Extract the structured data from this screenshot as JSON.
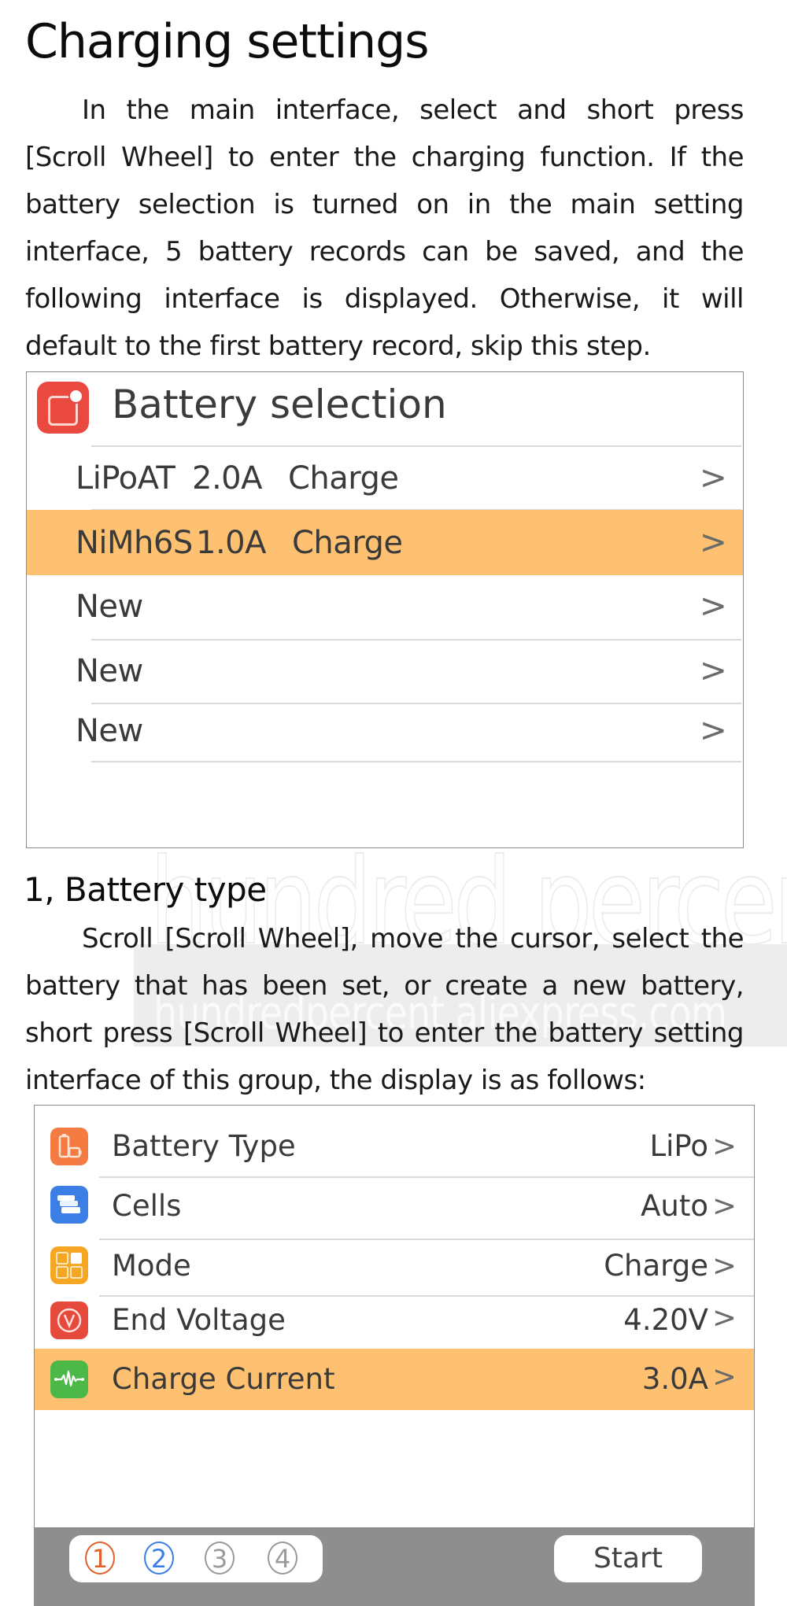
{
  "title": "Charging settings",
  "intro_paragraph": "In the main interface, select and short press [Scroll Wheel] to enter the charging function. If the battery selection is turned on in the main setting interface, 5 battery records can be saved, and the following interface is displayed. Otherwise, it will default to the first battery record, skip this step.",
  "battery_selection": {
    "title": "Battery selection",
    "icon": "app-badge-icon",
    "rows": [
      {
        "name": "LiPoAT",
        "current": "2.0A",
        "mode": "Charge",
        "chevron": ">",
        "selected": false
      },
      {
        "name": "NiMh6S",
        "current": "1.0A",
        "mode": "Charge",
        "chevron": ">",
        "selected": true
      },
      {
        "name": "New",
        "current": "",
        "mode": "",
        "chevron": ">",
        "selected": false
      },
      {
        "name": "New",
        "current": "",
        "mode": "",
        "chevron": ">",
        "selected": false
      },
      {
        "name": "New",
        "current": "",
        "mode": "",
        "chevron": ">",
        "selected": false
      }
    ]
  },
  "section1": {
    "heading": "1,  Battery type",
    "paragraph": "Scroll [Scroll Wheel], move the cursor, select the battery that has been set, or create a new battery, short press [Scroll Wheel] to enter the battery setting interface of this group, the display is as follows:"
  },
  "watermark": {
    "big": "hundred percent",
    "small": "hundredpercent.aliexpress.com"
  },
  "battery_settings": {
    "rows": [
      {
        "label": "Battery Type",
        "value": "LiPo",
        "icon": "battery-type-icon",
        "icon_color": "#f47c42",
        "selected": false
      },
      {
        "label": "Cells",
        "value": "Auto",
        "icon": "cells-stack-icon",
        "icon_color": "#3b7ee6",
        "selected": false
      },
      {
        "label": "Mode",
        "value": "Charge",
        "icon": "mode-grid-icon",
        "icon_color": "#f5a623",
        "selected": false
      },
      {
        "label": "End Voltage",
        "value": "4.20V",
        "icon": "voltage-icon",
        "icon_color": "#e64a3d",
        "selected": false
      },
      {
        "label": "Charge Current",
        "value": "3.0A",
        "icon": "waveform-icon",
        "icon_color": "#4cb848",
        "selected": true
      }
    ],
    "chevron": ">",
    "pager": [
      {
        "label": "1",
        "color": "#e0602e"
      },
      {
        "label": "2",
        "color": "#3b7ee6"
      },
      {
        "label": "3",
        "color": "#9a9a9a"
      },
      {
        "label": "4",
        "color": "#9a9a9a"
      }
    ],
    "start_label": "Start"
  },
  "colors": {
    "highlight": "#fdc171",
    "bottom_bar": "#8e8e8e"
  }
}
